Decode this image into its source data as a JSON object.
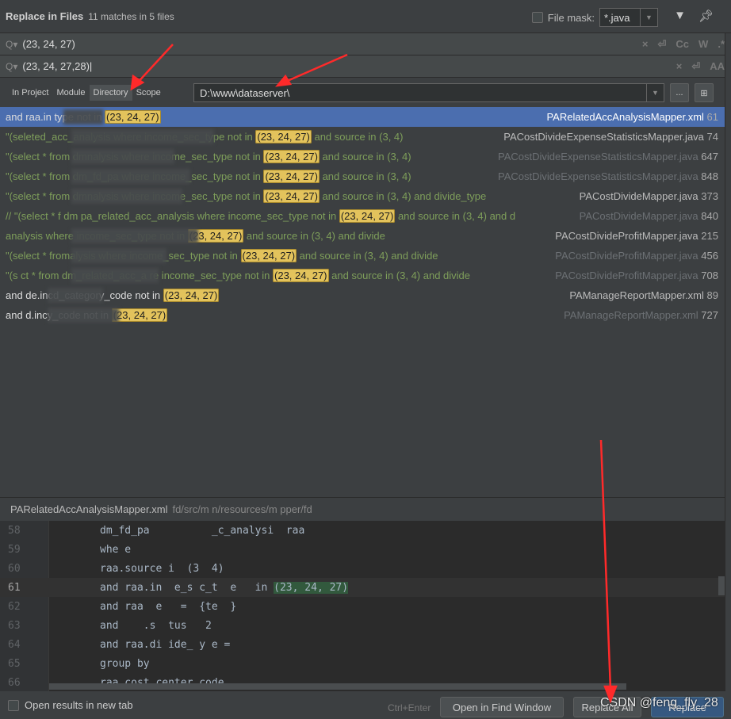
{
  "header": {
    "title": "Replace in Files",
    "subtitle": "11 matches in 5 files",
    "file_mask_label": "File mask:",
    "file_mask_value": "*.java",
    "file_mask_checked": false
  },
  "search": {
    "find_value": "(23, 24, 27)",
    "replace_value": "(23, 24, 27,28)",
    "find_icons": [
      "clear-icon",
      "newline-icon",
      "match-case-icon",
      "words-icon",
      "regex-icon"
    ],
    "find_icon_text": [
      "×",
      "⏎",
      "Cc",
      "W",
      ".*"
    ],
    "replace_icon_text": [
      "×",
      "⏎",
      "AA"
    ]
  },
  "scope": {
    "tabs": [
      "In Project",
      "Module",
      "Directory",
      "Scope"
    ],
    "active": "Directory",
    "directory": "D:\\www\\dataserver\\",
    "browse_label": "..."
  },
  "results": [
    {
      "prefix": "and raa.in",
      "suffix": " type not in ",
      "match": "(23, 24, 27)",
      "after": "",
      "file": "PARelatedAccAnalysisMapper.xml",
      "line": "61",
      "selected": true,
      "dim": false,
      "plain": true
    },
    {
      "prefix": "\"(sele",
      "suffix": "ted_acc_analysis where income_sec_type not in ",
      "match": "(23, 24, 27)",
      "after": " and source in (3, 4) ",
      "file": "PACostDivideExpenseStatisticsMapper.java",
      "line": "74",
      "dim": false
    },
    {
      "prefix": "\"(select * from dm",
      "suffix": "nalysis where income_sec_type not in ",
      "match": "(23, 24, 27)",
      "after": " and source in (3, 4)",
      "file": "PACostDivideExpenseStatisticsMapper.java",
      "line": "647",
      "dim": true
    },
    {
      "prefix": "\"(select * from dm_fd_pa",
      "suffix": " where income_sec_type not in ",
      "match": "(23, 24, 27)",
      "after": " and source in (3, 4)",
      "file": "PACostDivideExpenseStatisticsMapper.java",
      "line": "848",
      "dim": true
    },
    {
      "prefix": "\"(select * from dm",
      "suffix": "nalysis where income_sec_type not in ",
      "match": "(23, 24, 27)",
      "after": " and source in (3, 4) and divide_type",
      "file": "PACostDivideMapper.java",
      "line": "373",
      "dim": false
    },
    {
      "prefix": "//            \"(select * f",
      "suffix": " dm    pa_related_acc_analysis where income_sec_type not in ",
      "match": "(23, 24, 27)",
      "after": " and source in (3, 4) and d",
      "file": "PACostDivideMapper.java",
      "line": "840",
      "dim": true
    },
    {
      "prefix": "",
      "suffix": "analysis where income_sec_type not in ",
      "match": "(23, 24, 27)",
      "after": " and source in (3, 4) and divide",
      "file": "PACostDivideProfitMapper.java",
      "line": "215",
      "dim": false
    },
    {
      "prefix": "\"(select * from",
      "suffix": "alysis where income_sec_type not in ",
      "match": "(23, 24, 27)",
      "after": " and source in (3, 4) and divide",
      "file": "PACostDivideProfitMapper.java",
      "line": "456",
      "dim": true
    },
    {
      "prefix": "\"(s   ct * from dm",
      "suffix": "_related_acc_a   re income_sec_type not in ",
      "match": "(23, 24, 27)",
      "after": " and source in (3, 4) and divide",
      "file": "PACostDivideProfitMapper.java",
      "line": "708",
      "dim": true
    },
    {
      "prefix": "and de.inc",
      "suffix": "d_category_code not in ",
      "match": "(23, 24, 27)",
      "after": "",
      "file": "PAManageReportMapper.xml",
      "line": "89",
      "dim": false,
      "plain": true
    },
    {
      "prefix": "and d.inc",
      "suffix": "y_code not in ",
      "match": "(23, 24, 27)",
      "after": "",
      "file": "PAManageReportMapper.xml",
      "line": "727",
      "dim": true,
      "plain": true
    }
  ],
  "preview": {
    "file": "PARelatedAccAnalysisMapper.xml",
    "path": "fd/src/m  n/resources/m  pper/fd",
    "lines": [
      {
        "n": "58",
        "code": "dm_fd_pa          _c_analysi  raa"
      },
      {
        "n": "59",
        "code": "whe e"
      },
      {
        "n": "60",
        "code": "raa.source i  (3  4)"
      },
      {
        "n": "61",
        "code": "and raa.in  e_s c_t  e   in ",
        "match": "(23, 24, 27)",
        "current": true
      },
      {
        "n": "62",
        "code": "and raa  e   =  {te  }"
      },
      {
        "n": "63",
        "code": "and    .s  tus   2"
      },
      {
        "n": "64",
        "code": "and raa.di ide_ y e ="
      },
      {
        "n": "65",
        "code": "group by"
      },
      {
        "n": "66",
        "code": "raa.cost_center_code"
      }
    ]
  },
  "footer": {
    "open_new_tab_label": "Open results in new tab",
    "open_new_tab_checked": false,
    "shortcut": "Ctrl+Enter",
    "open_find_window": "Open in Find Window",
    "replace_all": "Replace All",
    "replace": "Replace"
  },
  "watermark": "CSDN @feng_fly_28",
  "colors": {
    "selection": "#4b6eaf",
    "match_highlight": "#e3c35c",
    "preview_match": "#32593d",
    "annotation_arrow": "#ff2a2a"
  }
}
